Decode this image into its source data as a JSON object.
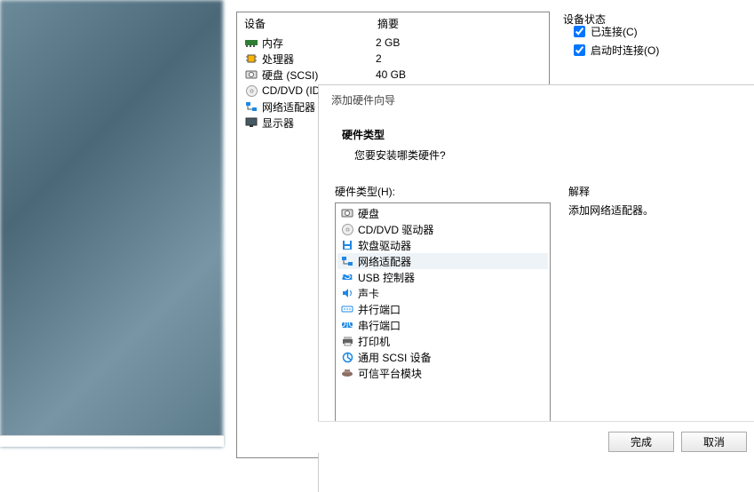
{
  "device_panel": {
    "header_device": "设备",
    "header_summary": "摘要",
    "items": [
      {
        "icon": "memory-icon",
        "label": "内存",
        "value": "2 GB"
      },
      {
        "icon": "cpu-icon",
        "label": "处理器",
        "value": "2"
      },
      {
        "icon": "disk-icon",
        "label": "硬盘 (SCSI)",
        "value": "40 GB"
      },
      {
        "icon": "cd-icon",
        "label": "CD/DVD (ID",
        "value": ""
      },
      {
        "icon": "network-icon",
        "label": "网络适配器",
        "value": ""
      },
      {
        "icon": "display-icon",
        "label": "显示器",
        "value": ""
      }
    ]
  },
  "status_panel": {
    "title": "设备状态",
    "connected": "已连接(C)",
    "connect_on_start": "启动时连接(O)"
  },
  "wizard": {
    "window_title": "添加硬件向导",
    "heading": "硬件类型",
    "subheading": "您要安装哪类硬件?",
    "list_label": "硬件类型(H):",
    "explain_label": "解释",
    "explain_text": "添加网络适配器。",
    "items": [
      {
        "icon": "disk-icon",
        "label": "硬盘"
      },
      {
        "icon": "cd-icon",
        "label": "CD/DVD 驱动器"
      },
      {
        "icon": "floppy-icon",
        "label": "软盘驱动器"
      },
      {
        "icon": "network-icon",
        "label": "网络适配器",
        "selected": true
      },
      {
        "icon": "usb-icon",
        "label": "USB 控制器"
      },
      {
        "icon": "sound-icon",
        "label": "声卡"
      },
      {
        "icon": "parallel-icon",
        "label": "并行端口"
      },
      {
        "icon": "serial-icon",
        "label": "串行端口"
      },
      {
        "icon": "printer-icon",
        "label": "打印机"
      },
      {
        "icon": "scsi-icon",
        "label": "通用 SCSI 设备"
      },
      {
        "icon": "tpm-icon",
        "label": "可信平台模块"
      }
    ],
    "finish_btn": "完成",
    "cancel_btn": "取消"
  },
  "icons": {
    "memory-icon": "#2e7d32",
    "cpu-icon": "#ffb300",
    "disk-icon": "#616161",
    "cd-icon": "#9e9e9e",
    "network-icon": "#1e88e5",
    "display-icon": "#424242",
    "floppy-icon": "#1e88e5",
    "usb-icon": "#1e88e5",
    "sound-icon": "#1e88e5",
    "parallel-icon": "#1e88e5",
    "serial-icon": "#1e88e5",
    "printer-icon": "#616161",
    "scsi-icon": "#1e88e5",
    "tpm-icon": "#8d6e63"
  }
}
